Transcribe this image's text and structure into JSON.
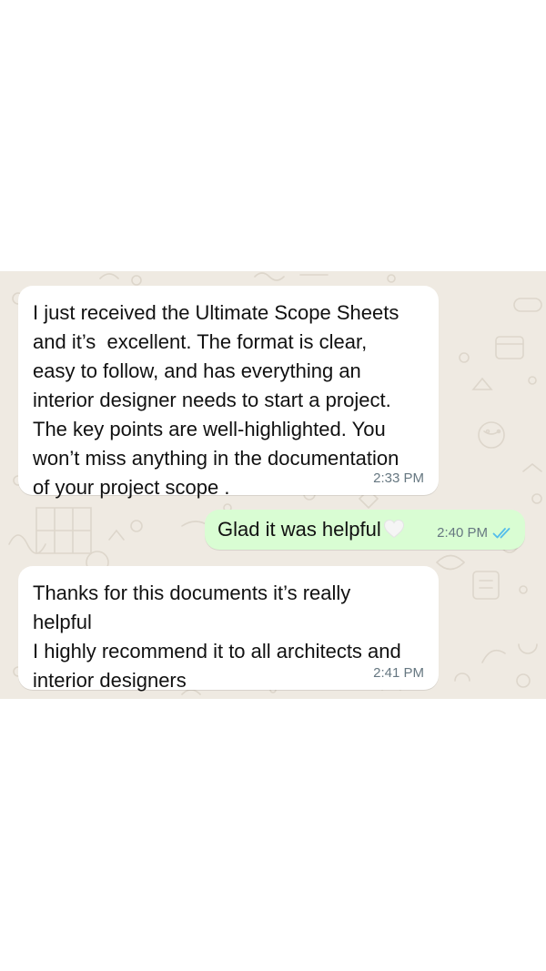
{
  "chat": {
    "messages": [
      {
        "direction": "incoming",
        "text": "I just received the Ultimate Scope Sheets\nand it’s  excellent. The format is clear,\neasy to follow, and has everything an\ninterior designer needs to start a project.\nThe key points are well-highlighted. You\nwon’t miss anything in the documentation\nof your project scope .",
        "time": "2:33 PM"
      },
      {
        "direction": "outgoing",
        "text": "Glad it was helpful",
        "emoji_icon": "white-heart-icon",
        "time": "2:40 PM",
        "status_icon": "double-check-read-icon",
        "status_color": "#53bdeb"
      },
      {
        "direction": "incoming",
        "text": "Thanks for this documents it’s really\nhelpful\nI highly recommend it to all architects and\ninterior designers",
        "time": "2:41 PM"
      }
    ]
  },
  "colors": {
    "chat_background": "#efeae2",
    "incoming_bubble": "#ffffff",
    "outgoing_bubble": "#d9fdd3",
    "timestamp": "#667781",
    "read_receipt": "#53bdeb"
  }
}
